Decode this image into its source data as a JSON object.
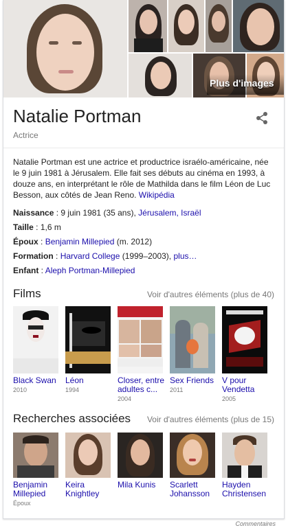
{
  "panel": {
    "name": "Natalie Portman",
    "subtitle": "Actrice",
    "more_images": "Plus d'images"
  },
  "description": {
    "text": "Natalie Portman est une actrice et productrice israélo-américaine, née le 9 juin 1981 à Jérusalem. Elle fait ses débuts au cinéma en 1993, à douze ans, en interprétant le rôle de Mathilda dans le film Léon de Luc Besson, aux côtés de Jean Reno.",
    "source": "Wikipédia"
  },
  "facts": {
    "birth_label": "Naissance",
    "birth_value": "9 juin 1981 (35 ans),",
    "birth_place": "Jérusalem, Israël",
    "height_label": "Taille",
    "height_value": "1,6 m",
    "spouse_label": "Époux",
    "spouse_link": "Benjamin Millepied",
    "spouse_extra": "(m. 2012)",
    "education_label": "Formation",
    "education_link": "Harvard College",
    "education_extra": "(1999–2003),",
    "education_more": "plus…",
    "child_label": "Enfant",
    "child_link": "Aleph Portman-Millepied"
  },
  "films": {
    "title": "Films",
    "more": "Voir d'autres éléments (plus de 40)",
    "items": [
      {
        "title": "Black Swan",
        "sub": "2010"
      },
      {
        "title": "Léon",
        "sub": "1994"
      },
      {
        "title": "Closer, entre adultes c...",
        "sub": "2004"
      },
      {
        "title": "Sex Friends",
        "sub": "2011"
      },
      {
        "title": "V pour Vendetta",
        "sub": "2005"
      }
    ]
  },
  "related": {
    "title": "Recherches associées",
    "more": "Voir d'autres éléments (plus de 15)",
    "items": [
      {
        "title": "Benjamin Millepied",
        "sub": "Époux"
      },
      {
        "title": "Keira Knightley",
        "sub": ""
      },
      {
        "title": "Mila Kunis",
        "sub": ""
      },
      {
        "title": "Scarlett Johansson",
        "sub": ""
      },
      {
        "title": "Hayden Christensen",
        "sub": ""
      }
    ]
  },
  "footer": "Commentaires",
  "icons": {
    "share": "share-icon"
  },
  "colors": {
    "link": "#1a0dab",
    "muted": "#777777",
    "text": "#222222"
  }
}
